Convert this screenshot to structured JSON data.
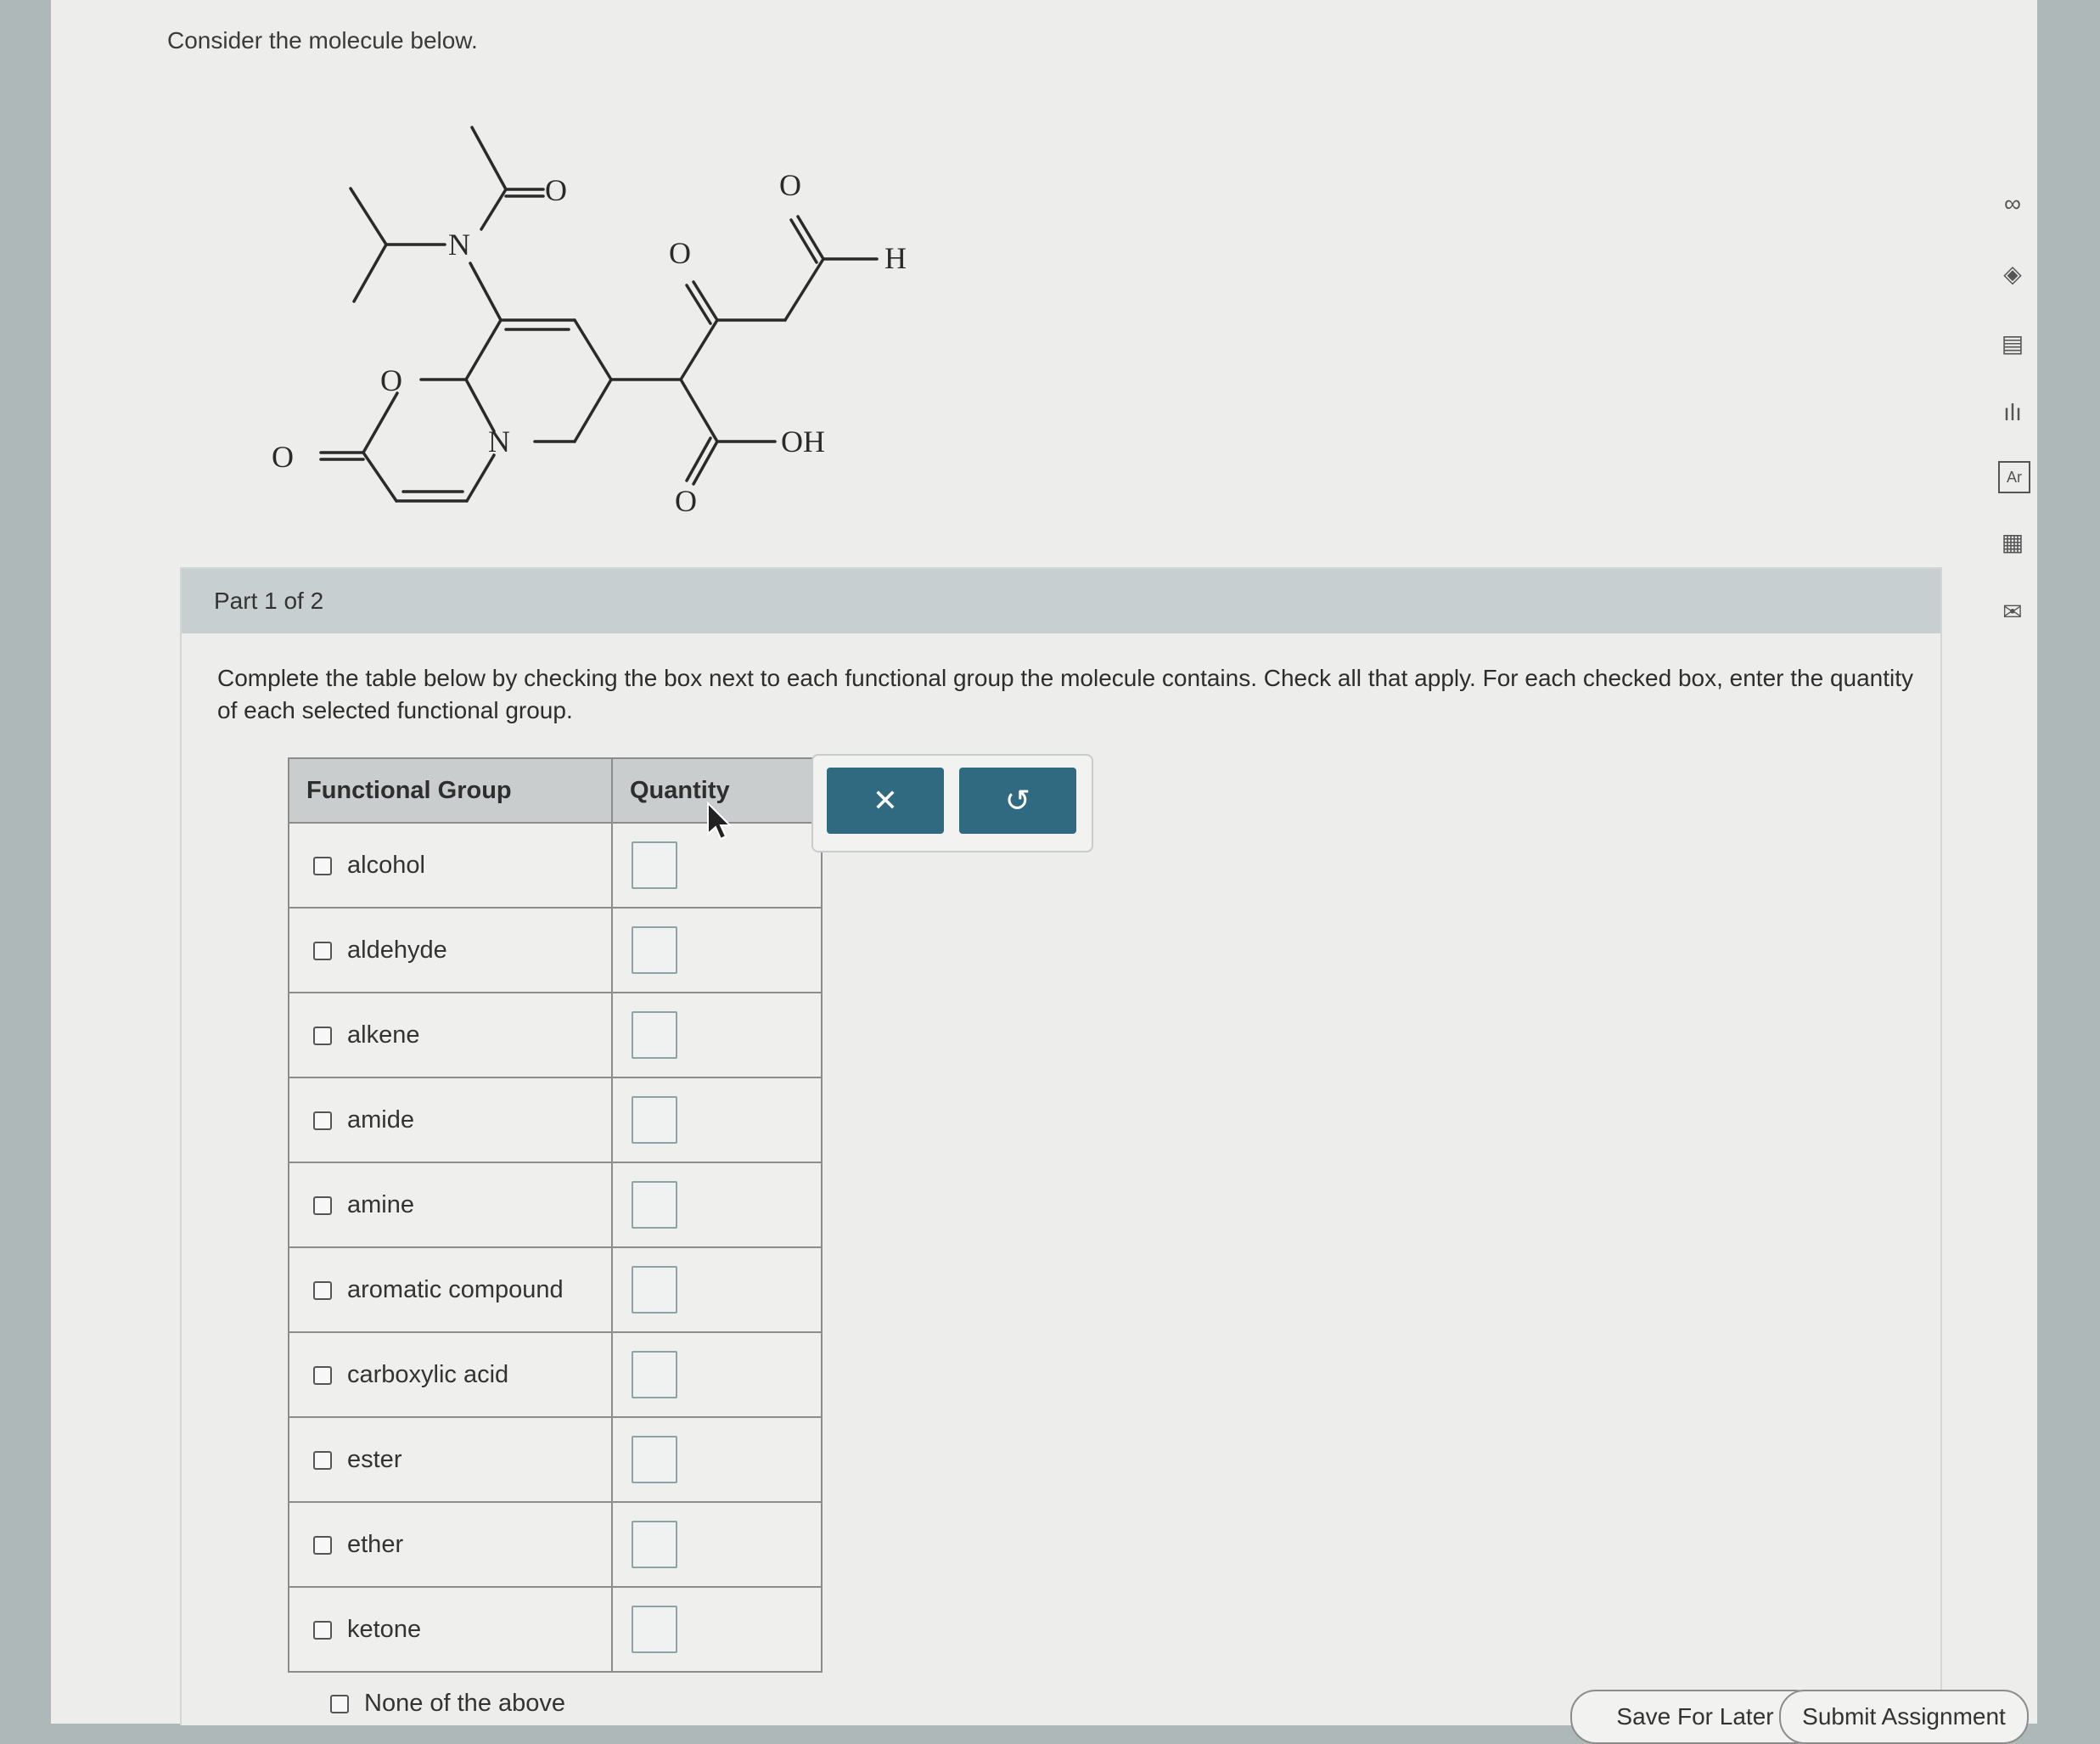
{
  "prompt": "Consider the molecule below.",
  "molecule_labels": {
    "n1": "N",
    "o_amide": "O",
    "o_ring": "O",
    "o_lactone": "O",
    "n2": "N",
    "o_ketone": "O",
    "o_aldehyde": "O",
    "h_aldehyde": "H",
    "oh_acid": "OH",
    "o_acid": "O"
  },
  "part": {
    "header": "Part 1 of 2",
    "instructions": "Complete the table below by checking the box next to each functional group the molecule contains. Check all that apply. For each checked box, enter the quantity of each selected functional group."
  },
  "table": {
    "headers": [
      "Functional Group",
      "Quantity"
    ],
    "rows": [
      {
        "label": "alcohol",
        "checked": false,
        "quantity": ""
      },
      {
        "label": "aldehyde",
        "checked": false,
        "quantity": ""
      },
      {
        "label": "alkene",
        "checked": false,
        "quantity": ""
      },
      {
        "label": "amide",
        "checked": false,
        "quantity": ""
      },
      {
        "label": "amine",
        "checked": false,
        "quantity": ""
      },
      {
        "label": "aromatic compound",
        "checked": false,
        "quantity": ""
      },
      {
        "label": "carboxylic acid",
        "checked": false,
        "quantity": ""
      },
      {
        "label": "ester",
        "checked": false,
        "quantity": ""
      },
      {
        "label": "ether",
        "checked": false,
        "quantity": ""
      },
      {
        "label": "ketone",
        "checked": false,
        "quantity": ""
      }
    ],
    "none_label": "None of the above"
  },
  "buttons": {
    "clear": "✕",
    "reset": "↺"
  },
  "side_tools": [
    {
      "icon": "infinity-icon",
      "glyph": "∞"
    },
    {
      "icon": "hint-icon",
      "glyph": "◈"
    },
    {
      "icon": "notes-icon",
      "glyph": "▤"
    },
    {
      "icon": "chart-icon",
      "glyph": "ılı"
    },
    {
      "icon": "periodic-table-icon",
      "glyph": "Ar"
    },
    {
      "icon": "calculator-icon",
      "glyph": "▦"
    },
    {
      "icon": "mail-icon",
      "glyph": "✉"
    }
  ],
  "footer": {
    "save_later": "Save For Later",
    "submit": "Submit Assignment"
  },
  "colors": {
    "button_bg": "#2f6a80",
    "header_bg": "#c8cfd0",
    "page_bg": "#ededeb"
  }
}
